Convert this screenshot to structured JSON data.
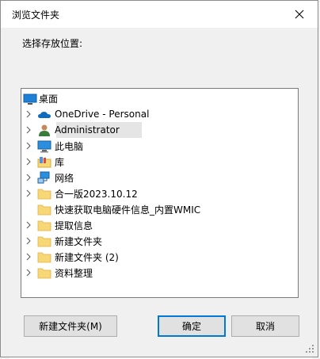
{
  "window": {
    "title": "浏览文件夹",
    "close_icon": "close-icon"
  },
  "prompt": "选择存放位置:",
  "tree": {
    "root": {
      "label": "桌面",
      "icon": "desktop-icon"
    },
    "items": [
      {
        "label": "OneDrive - Personal",
        "icon": "cloud-icon",
        "expandable": true,
        "selected": false
      },
      {
        "label": "Administrator",
        "icon": "user-icon",
        "expandable": true,
        "selected": true
      },
      {
        "label": "此电脑",
        "icon": "computer-icon",
        "expandable": true,
        "selected": false
      },
      {
        "label": "库",
        "icon": "library-icon",
        "expandable": true,
        "selected": false
      },
      {
        "label": "网络",
        "icon": "network-icon",
        "expandable": true,
        "selected": false
      },
      {
        "label": "合一版2023.10.12",
        "icon": "folder-icon",
        "expandable": true,
        "selected": false
      },
      {
        "label": "快速获取电脑硬件信息_内置WMIC",
        "icon": "folder-icon",
        "expandable": false,
        "selected": false
      },
      {
        "label": "提取信息",
        "icon": "folder-icon",
        "expandable": true,
        "selected": false
      },
      {
        "label": "新建文件夹",
        "icon": "folder-icon",
        "expandable": true,
        "selected": false
      },
      {
        "label": "新建文件夹 (2)",
        "icon": "folder-icon",
        "expandable": true,
        "selected": false
      },
      {
        "label": "资料整理",
        "icon": "folder-icon",
        "expandable": true,
        "selected": false
      }
    ]
  },
  "buttons": {
    "new_folder": "新建文件夹(M)",
    "ok": "确定",
    "cancel": "取消"
  },
  "colors": {
    "accent": "#0078d7",
    "folder": "#f8d775",
    "selection": "#e5e5e5"
  }
}
